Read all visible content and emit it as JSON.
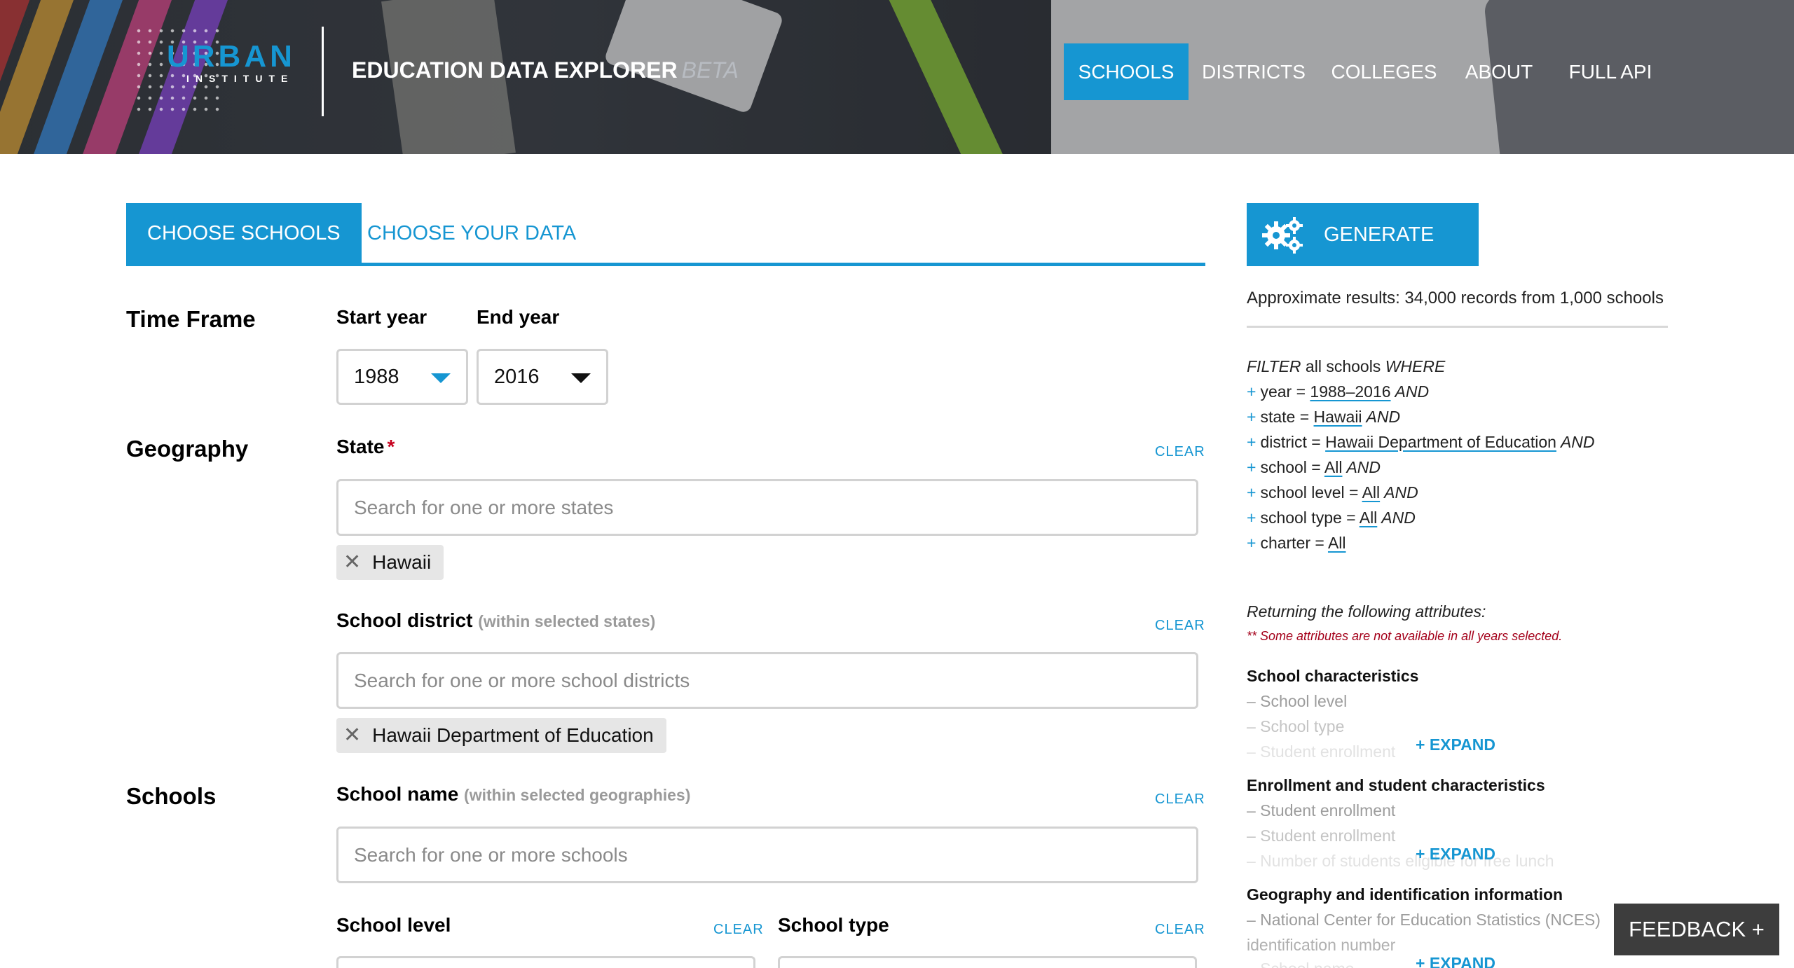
{
  "header": {
    "logo_word": "URBAN",
    "logo_sub": "INSTITUTE",
    "app_title": "EDUCATION DATA EXPLORER",
    "app_badge": "BETA",
    "nav": [
      "SCHOOLS",
      "DISTRICTS",
      "COLLEGES",
      "ABOUT",
      "FULL API"
    ],
    "active_nav": "SCHOOLS"
  },
  "tabs": [
    "CHOOSE SCHOOLS",
    "CHOOSE YOUR DATA"
  ],
  "active_tab": "CHOOSE SCHOOLS",
  "sections": {
    "time_frame": "Time Frame",
    "geography": "Geography",
    "schools": "Schools"
  },
  "time_frame": {
    "start_label": "Start year",
    "start_value": "1988",
    "end_label": "End year",
    "end_value": "2016"
  },
  "geography": {
    "state_label": "State",
    "state_required": "*",
    "state_clear": "CLEAR",
    "state_placeholder": "Search for one or more states",
    "state_chip": "Hawaii",
    "district_label": "School district",
    "district_sub": "(within selected states)",
    "district_clear": "CLEAR",
    "district_placeholder": "Search for one or more school districts",
    "district_chip": "Hawaii Department of Education"
  },
  "schools": {
    "name_label": "School name",
    "name_sub": "(within selected geographies)",
    "name_clear": "CLEAR",
    "name_placeholder": "Search for one or more schools",
    "level_label": "School level",
    "level_clear": "CLEAR",
    "type_label": "School type",
    "type_clear": "CLEAR"
  },
  "chip_remove": "✕",
  "panel": {
    "generate_label": "GENERATE",
    "approx": "Approximate results: 34,000 records from 1,000 schools",
    "filter_prefix": "FILTER",
    "filter_mid": "all schools",
    "filter_suffix": "WHERE",
    "plus": "+",
    "and": "AND",
    "filters": [
      {
        "key": "year =",
        "value": "1988–2016"
      },
      {
        "key": "state =",
        "value": "Hawaii"
      },
      {
        "key": "district =",
        "value": "Hawaii Department of Education"
      },
      {
        "key": "school =",
        "value": "All"
      },
      {
        "key": "school level =",
        "value": "All"
      },
      {
        "key": "school type =",
        "value": "All"
      },
      {
        "key": "charter =",
        "value": "All"
      }
    ],
    "returning": "Returning the following attributes:",
    "note": "** Some attributes are not available in all years selected.",
    "expand": "+ EXPAND",
    "groups": [
      {
        "title": "School characteristics",
        "items": [
          "– School level",
          "– School type"
        ],
        "faded": "– Student enrollment"
      },
      {
        "title": "Enrollment and student characteristics",
        "items": [
          "– Student enrollment",
          "– Student enrollment"
        ],
        "faded": "– Number of students eligible for free lunch"
      },
      {
        "title": "Geography and identification information",
        "items": [
          "– National Center for Education Statistics (NCES)",
          "identification number"
        ],
        "faded": "– School name"
      }
    ]
  },
  "feedback": "FEEDBACK +",
  "colors": {
    "accent": "#1696d2",
    "required": "#c6001e",
    "feedback_bg": "#3d3d3d"
  },
  "icons": [
    "gears-icon",
    "close-icon",
    "caret-down-icon"
  ]
}
